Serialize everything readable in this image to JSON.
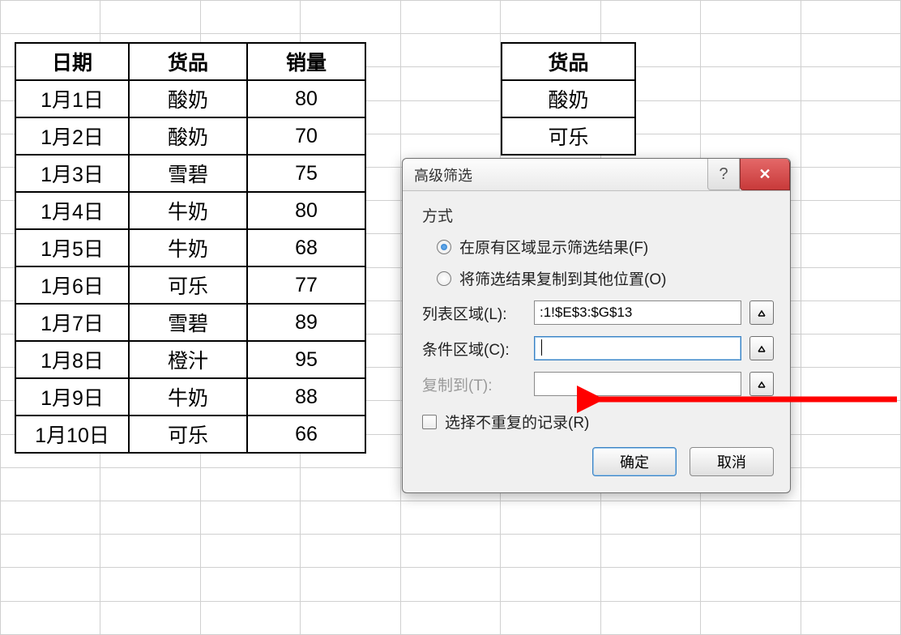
{
  "table": {
    "headers": [
      "日期",
      "货品",
      "销量"
    ],
    "rows": [
      [
        "1月1日",
        "酸奶",
        "80"
      ],
      [
        "1月2日",
        "酸奶",
        "70"
      ],
      [
        "1月3日",
        "雪碧",
        "75"
      ],
      [
        "1月4日",
        "牛奶",
        "80"
      ],
      [
        "1月5日",
        "牛奶",
        "68"
      ],
      [
        "1月6日",
        "可乐",
        "77"
      ],
      [
        "1月7日",
        "雪碧",
        "89"
      ],
      [
        "1月8日",
        "橙汁",
        "95"
      ],
      [
        "1月9日",
        "牛奶",
        "88"
      ],
      [
        "1月10日",
        "可乐",
        "66"
      ]
    ]
  },
  "criteria": {
    "header": "货品",
    "rows": [
      "酸奶",
      "可乐"
    ]
  },
  "dialog": {
    "title": "高级筛选",
    "group_label": "方式",
    "radio1": "在原有区域显示筛选结果(F)",
    "radio2": "将筛选结果复制到其他位置(O)",
    "list_label": "列表区域(L):",
    "list_value": ":1!$E$3:$G$13",
    "cond_label": "条件区域(C):",
    "cond_value": "",
    "copy_label": "复制到(T):",
    "copy_value": "",
    "checkbox_label": "选择不重复的记录(R)",
    "ok": "确定",
    "cancel": "取消"
  }
}
